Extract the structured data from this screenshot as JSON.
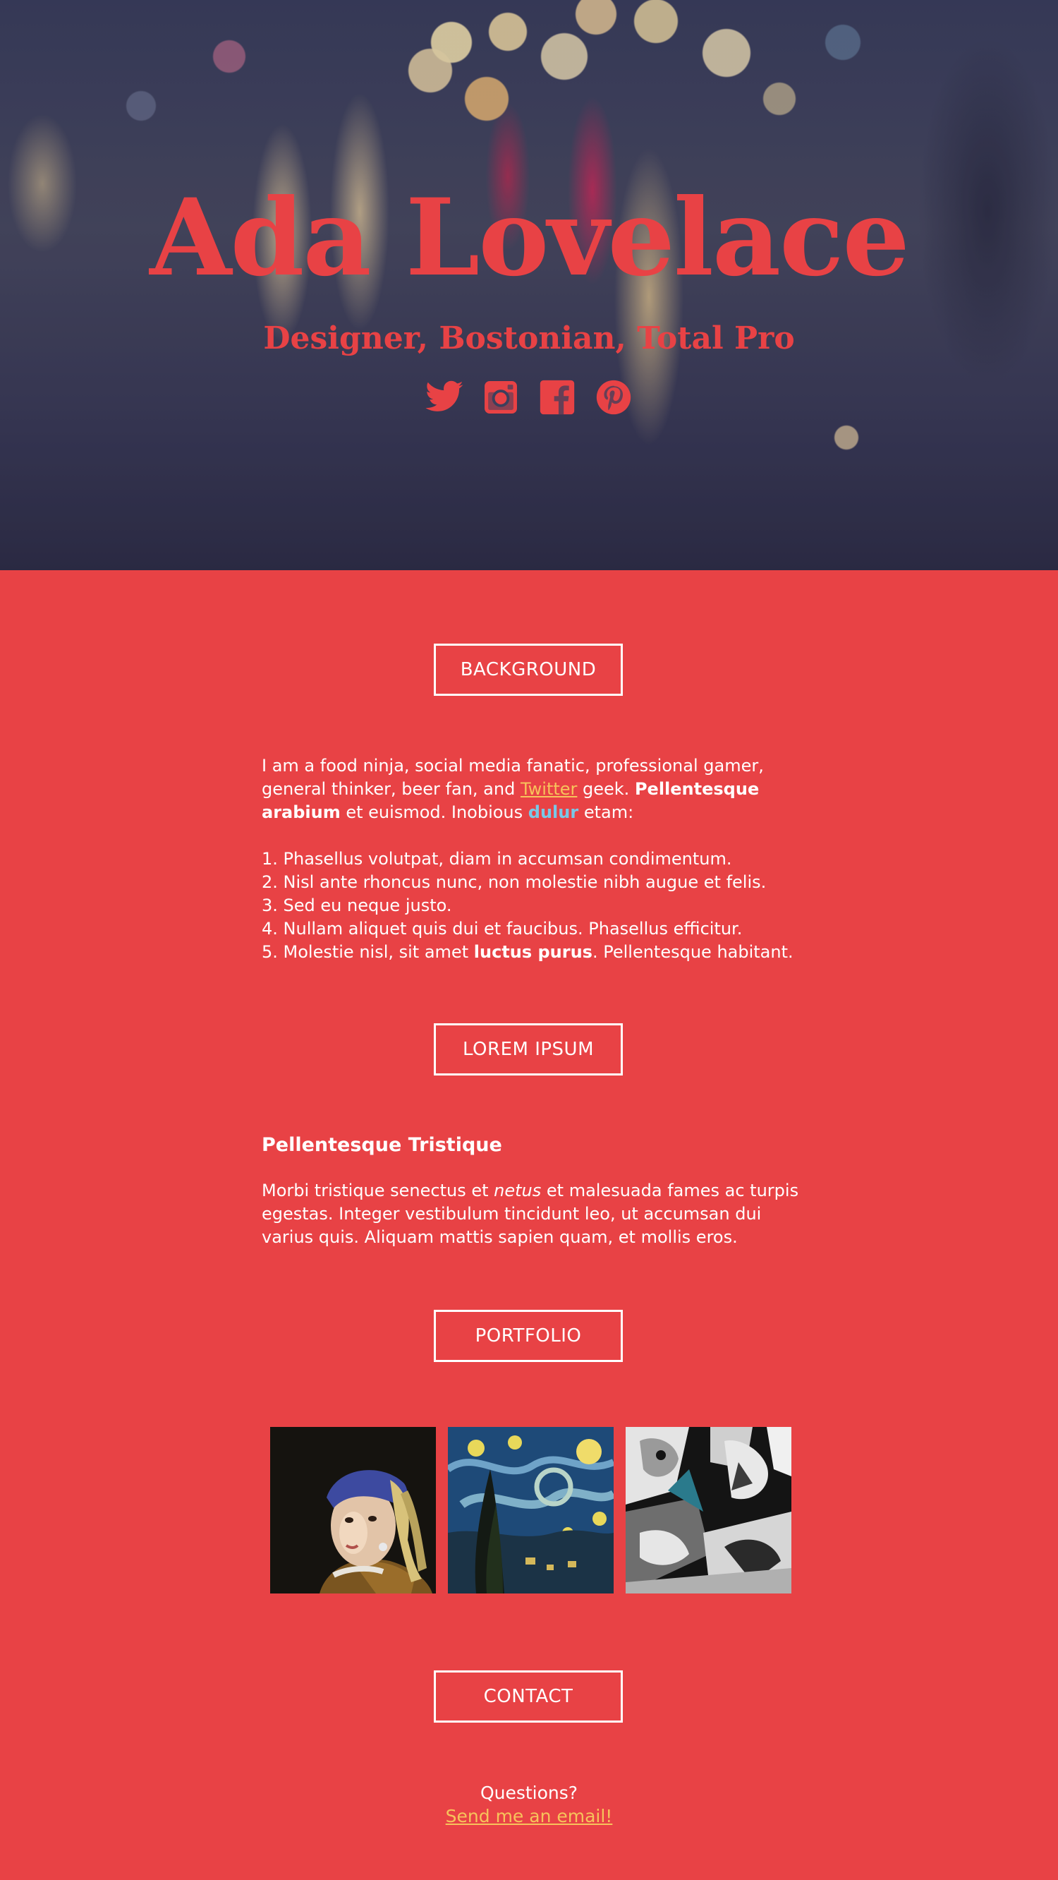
{
  "hero": {
    "title": "Ada Lovelace",
    "subtitle": "Designer, Bostonian, Total Pro",
    "social": [
      {
        "icon": "twitter-icon"
      },
      {
        "icon": "instagram-icon"
      },
      {
        "icon": "facebook-icon"
      },
      {
        "icon": "pinterest-icon"
      }
    ]
  },
  "colors": {
    "brand_red": "#e84245",
    "link_yellow": "#f7c35b",
    "link_blue": "#79c8e6",
    "text": "#ffffff"
  },
  "background": {
    "button": "BACKGROUND",
    "intro_1": "I am a food ninja, social media fanatic, professional gamer, general thinker, beer fan, and ",
    "twitter_link": "Twitter",
    "intro_2": " geek. ",
    "bold_1": "Pellentesque arabium",
    "intro_3": " et euismod. Inobious ",
    "dulur_link": "dulur",
    "intro_4": " etam:",
    "items": [
      {
        "text": "1. Phasellus volutpat, diam in accumsan condimentum."
      },
      {
        "text": "2. Nisl ante rhoncus nunc, non molestie nibh augue et felis."
      },
      {
        "text": "3. Sed eu neque justo."
      },
      {
        "text": "4. Nullam aliquet quis dui et faucibus. Phasellus efficitur."
      }
    ],
    "item5_pre": "5. Molestie nisl, sit amet ",
    "item5_bold": "luctus purus",
    "item5_post": ". Pellentesque habitant."
  },
  "lorem": {
    "button": "LOREM IPSUM",
    "heading": "Pellentesque Tristique",
    "para_1": "Morbi tristique senectus et ",
    "para_italic": "netus",
    "para_2": " et malesuada fames ac turpis egestas. Integer vestibulum tincidunt leo, ut accumsan dui varius quis. Aliquam mattis sapien quam, et mollis eros."
  },
  "portfolio": {
    "button": "PORTFOLIO"
  },
  "contact": {
    "button": "CONTACT",
    "question": "Questions?",
    "email_link": "Send me an email!"
  }
}
